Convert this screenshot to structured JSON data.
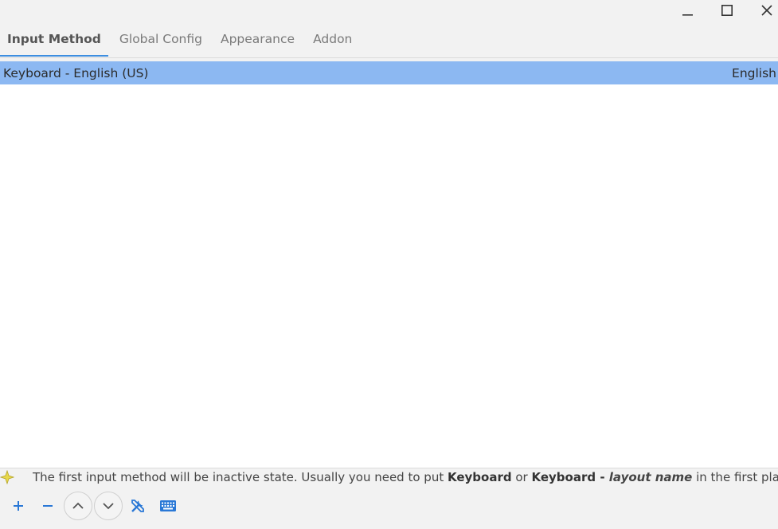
{
  "window": {
    "controls": [
      "minimize",
      "maximize",
      "close"
    ]
  },
  "tabs": [
    {
      "label": "Input Method",
      "active": true
    },
    {
      "label": "Global Config",
      "active": false
    },
    {
      "label": "Appearance",
      "active": false
    },
    {
      "label": "Addon",
      "active": false
    }
  ],
  "input_methods": [
    {
      "name": "Keyboard - English (US)",
      "language": "English",
      "selected": true
    }
  ],
  "hint": {
    "prefix": "The first input method will be inactive state. Usually you need to put ",
    "bold1": "Keyboard",
    "middle": " or ",
    "bold2": "Keyboard - ",
    "italic": "layout name",
    "suffix": " in the first place."
  },
  "toolbar": {
    "icons": [
      "add-icon",
      "remove-icon",
      "move-up-icon",
      "move-down-icon",
      "configure-icon",
      "keyboard-layout-icon"
    ]
  },
  "colors": {
    "accent": "#3d8ee0",
    "selection": "#8cb8f2",
    "icon_blue": "#2a78d6"
  }
}
